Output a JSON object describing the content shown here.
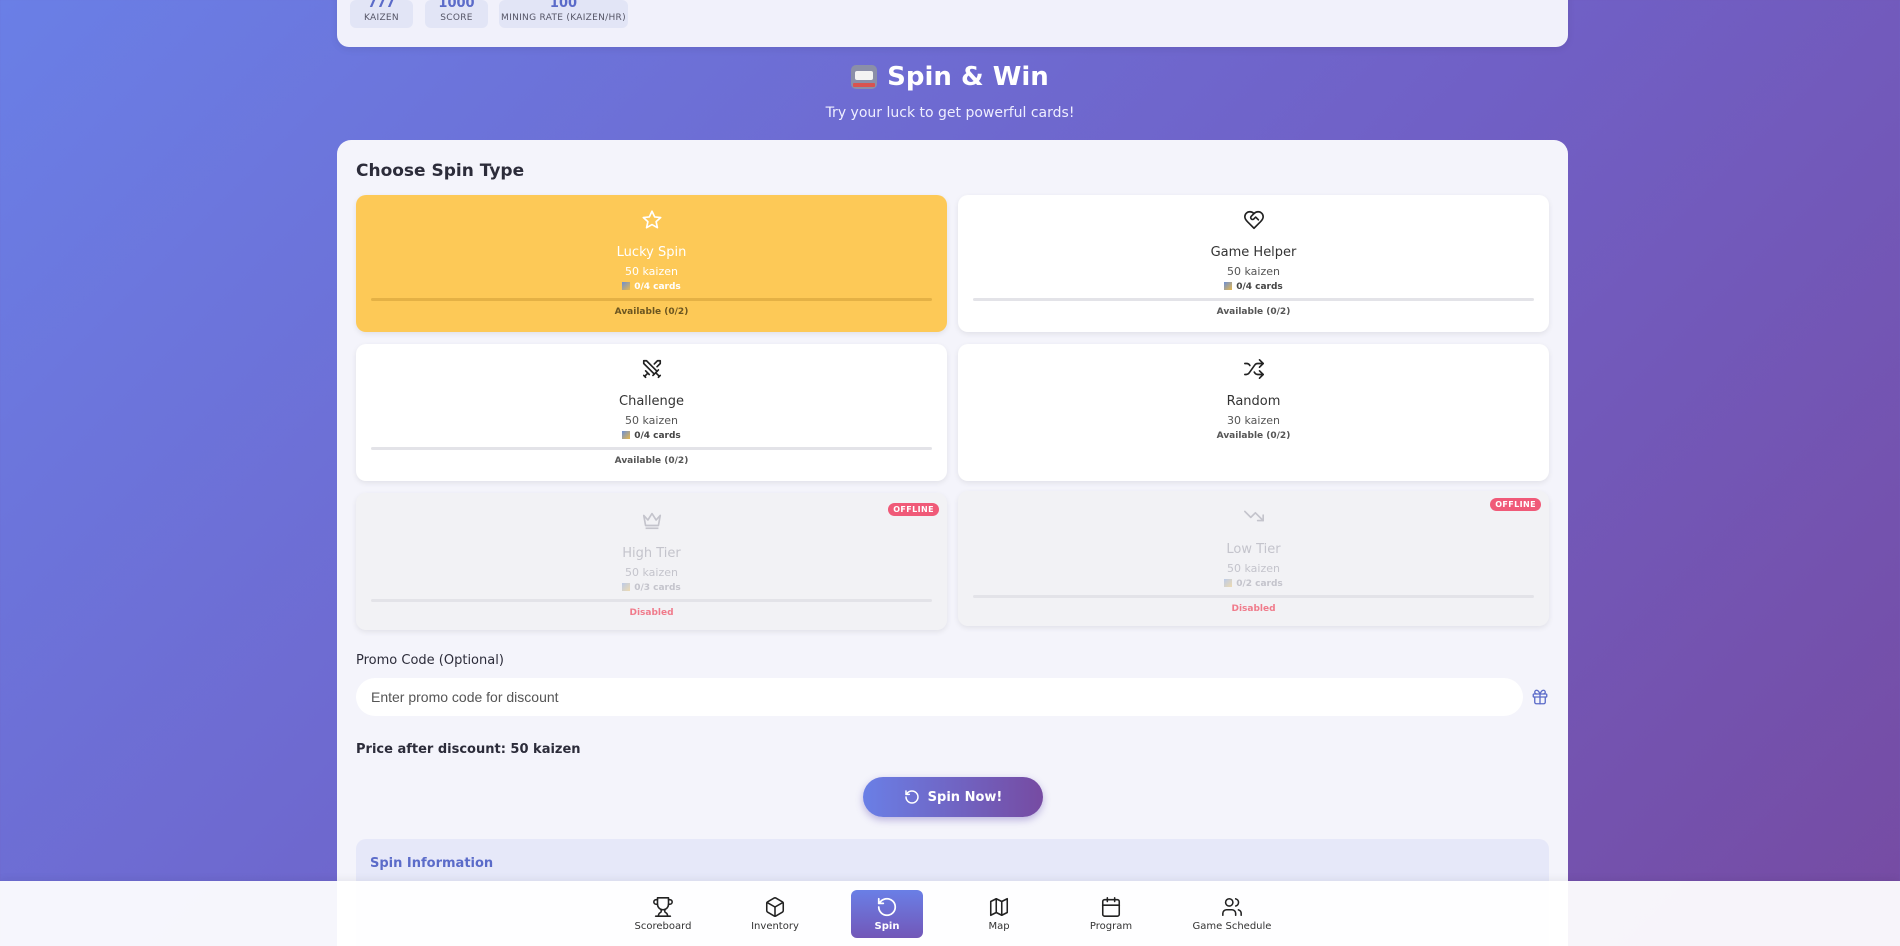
{
  "stats": [
    {
      "value": "777",
      "label": "KAIZEN"
    },
    {
      "value": "1000",
      "label": "SCORE"
    },
    {
      "value": "100",
      "label": "MINING RATE (KAIZEN/HR)"
    }
  ],
  "hero": {
    "title": "Spin & Win",
    "subtitle": "Try your luck to get powerful cards!"
  },
  "section_title": "Choose Spin Type",
  "spin_types": [
    {
      "name": "Lucky Spin",
      "price": "50 kaizen",
      "cards": "0/4 cards",
      "status": "Available (0/2)",
      "icon": "star-icon",
      "selected": true
    },
    {
      "name": "Game Helper",
      "price": "50 kaizen",
      "cards": "0/4 cards",
      "status": "Available (0/2)",
      "icon": "heart-handshake-icon"
    },
    {
      "name": "Challenge",
      "price": "50 kaizen",
      "cards": "0/4 cards",
      "status": "Available (0/2)",
      "icon": "swords-icon"
    },
    {
      "name": "Random",
      "price": "30 kaizen",
      "status": "Available (0/2)",
      "icon": "shuffle-icon"
    },
    {
      "name": "High Tier",
      "price": "50 kaizen",
      "cards": "0/3 cards",
      "status": "Disabled",
      "badge": "OFFLINE",
      "icon": "crown-icon"
    },
    {
      "name": "Low Tier",
      "price": "50 kaizen",
      "cards": "0/2 cards",
      "status": "Disabled",
      "badge": "OFFLINE",
      "icon": "trending-down-icon"
    }
  ],
  "promo": {
    "label": "Promo Code (Optional)",
    "placeholder": "Enter promo code for discount"
  },
  "price_after": "Price after discount: 50 kaizen",
  "spin_button": "Spin Now!",
  "info_title": "Spin Information",
  "nav": [
    {
      "label": "Scoreboard",
      "icon": "trophy-icon"
    },
    {
      "label": "Inventory",
      "icon": "box-icon"
    },
    {
      "label": "Spin",
      "icon": "rotate-icon",
      "active": true
    },
    {
      "label": "Map",
      "icon": "map-icon"
    },
    {
      "label": "Program",
      "icon": "calendar-icon"
    },
    {
      "label": "Game Schedule",
      "icon": "users-icon"
    }
  ]
}
